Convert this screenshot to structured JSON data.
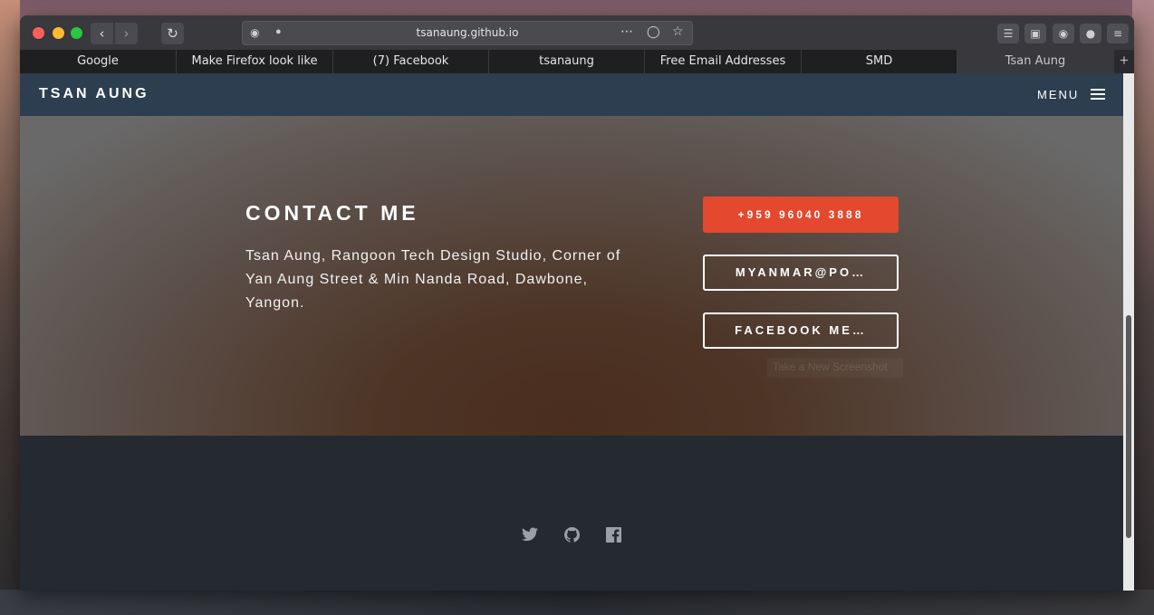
{
  "browser": {
    "url": "tsanaung.github.io",
    "tabs": [
      {
        "label": "Google"
      },
      {
        "label": "Make Firefox look like"
      },
      {
        "label": "(7) Facebook"
      },
      {
        "label": "tsanaung"
      },
      {
        "label": "Free Email Addresses"
      },
      {
        "label": "SMD"
      },
      {
        "label": "Tsan Aung"
      }
    ],
    "new_tab_label": "+",
    "nav_icons": {
      "back": "chevron-left-icon",
      "forward": "chevron-right-icon",
      "reload": "reload-icon"
    },
    "toolbar_icons": [
      "library-icon",
      "sidebar-icon",
      "extension-icon",
      "account-icon",
      "hamburger-menu-icon"
    ]
  },
  "site": {
    "brand": "TSAN AUNG",
    "menu_label": "MENU"
  },
  "contact": {
    "title": "CONTACT ME",
    "address": "Tsan Aung, Rangoon Tech Design Studio, Corner of Yan Aung Street & Min Nanda Road, Dawbone, Yangon.",
    "phone_button": "+959 96040 3888",
    "email_button": "MYANMAR@PO…",
    "facebook_button": "FACEBOOK ME…",
    "overlay_hint": "Take a New Screenshot",
    "accent_color": "#e4482f"
  },
  "footer": {
    "social_icons": [
      "twitter-icon",
      "github-icon",
      "facebook-icon"
    ]
  }
}
